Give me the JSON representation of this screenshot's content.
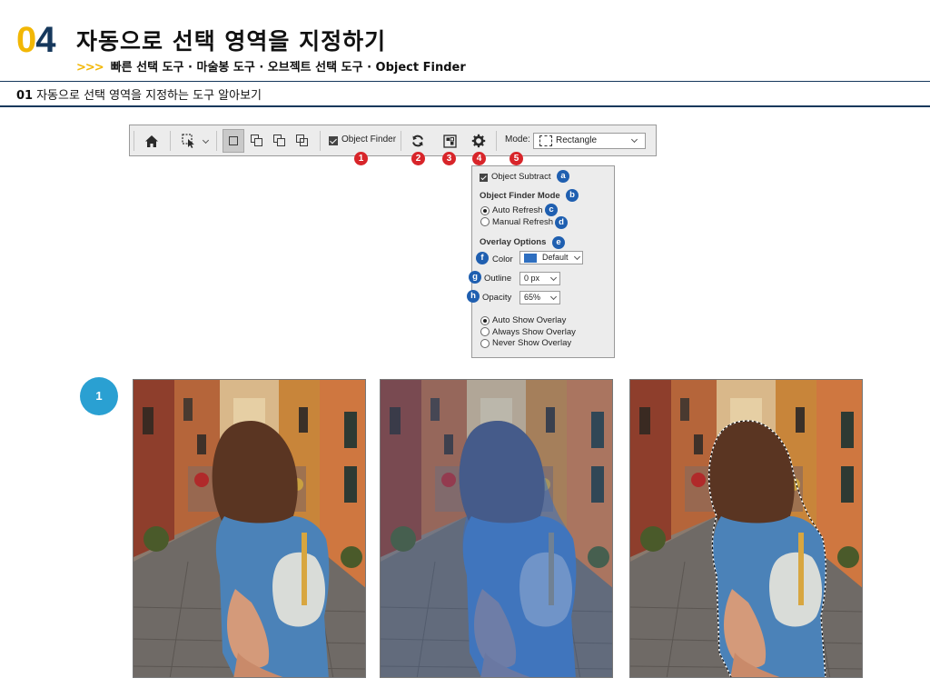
{
  "header": {
    "chapter_number_first": "0",
    "chapter_number_second": "4",
    "title": "자동으로 선택 영역을 지정하기",
    "subtitle_arrows": ">>>",
    "subtitle": "빠른 선택 도구 · 마술봉 도구 · 오브젝트 선택 도구 · Object Finder"
  },
  "section": {
    "number": "01",
    "title": "자동으로 선택 영역을 지정하는 도구 알아보기"
  },
  "options_bar": {
    "home_icon": "home-icon",
    "tool_icon": "object-selection-tool-icon",
    "mode_icons": [
      "new-selection-icon",
      "add-to-selection-icon",
      "subtract-from-selection-icon",
      "intersect-selection-icon"
    ],
    "object_finder_label": "Object Finder",
    "refresh_icon": "refresh-icon",
    "show_all_icon": "show-all-objects-icon",
    "settings_icon": "gear-icon",
    "mode_label": "Mode:",
    "mode_value": "Rectangle",
    "markers": [
      "1",
      "2",
      "3",
      "4",
      "5"
    ]
  },
  "settings_panel": {
    "object_subtract": "Object Subtract",
    "finder_mode_heading": "Object Finder Mode",
    "auto_refresh": "Auto Refresh",
    "manual_refresh": "Manual Refresh",
    "overlay_heading": "Overlay Options",
    "color_label": "Color",
    "color_value": "Default",
    "outline_label": "Outline",
    "outline_value": "0 px",
    "opacity_label": "Opacity",
    "opacity_value": "65%",
    "auto_show": "Auto Show Overlay",
    "always_show": "Always Show Overlay",
    "never_show": "Never Show Overlay",
    "markers": [
      "a",
      "b",
      "c",
      "d",
      "e",
      "f",
      "g",
      "h"
    ],
    "swatch_color": "#2f6fc0"
  },
  "step": {
    "label": "1"
  },
  "colors": {
    "accent_yellow": "#f2b705",
    "navy": "#16385c",
    "marker_red": "#d8252a",
    "marker_blue": "#1f5fb0",
    "step_blue": "#2aa0d2"
  }
}
